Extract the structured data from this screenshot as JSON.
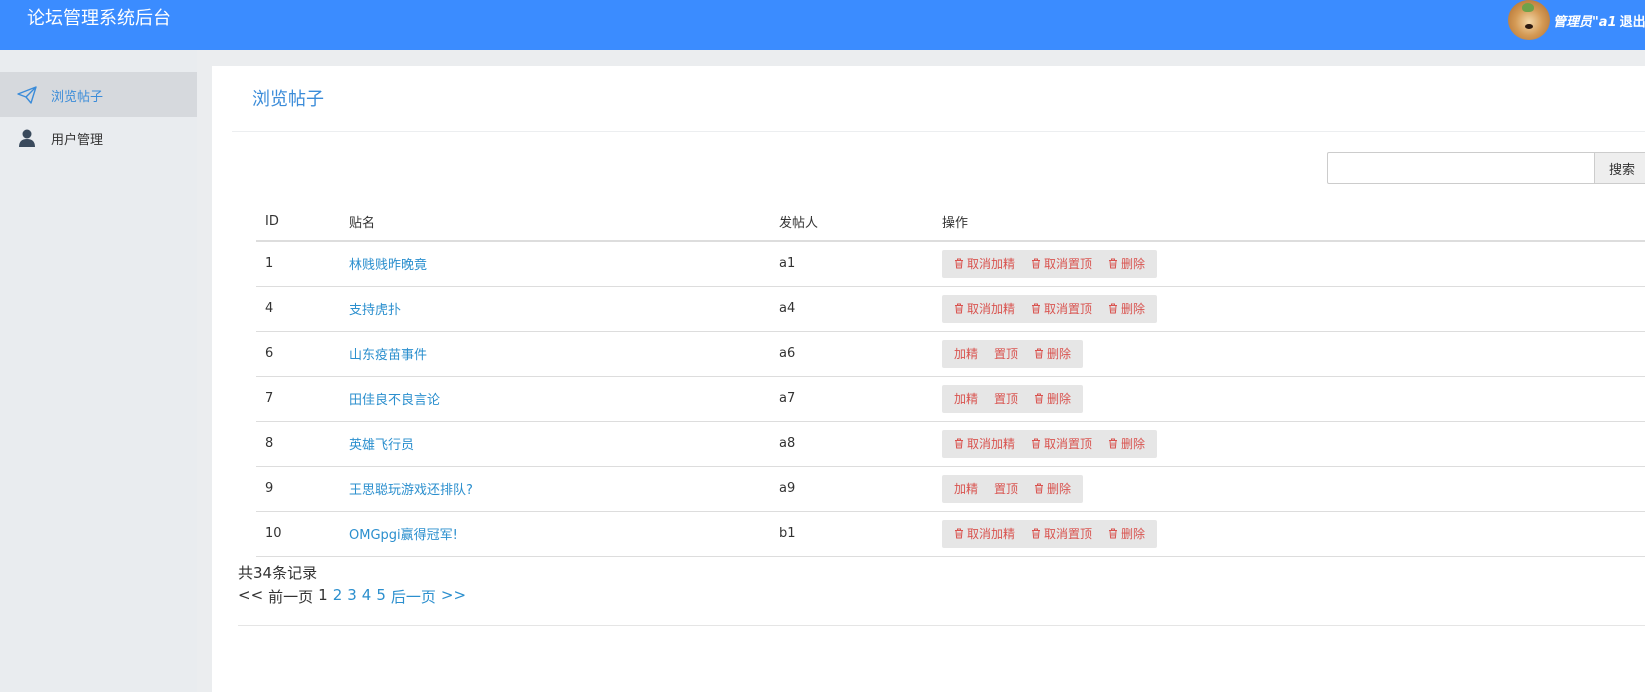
{
  "header": {
    "app_title": "论坛管理系统后台",
    "user_label": "管理员\"a1",
    "logout_label": "退出",
    "brand_color": "#3b8cff"
  },
  "sidebar": {
    "items": [
      {
        "label": "浏览帖子",
        "icon": "paper-plane-icon",
        "active": true
      },
      {
        "label": "用户管理",
        "icon": "user-icon",
        "active": false
      }
    ]
  },
  "main": {
    "page_title": "浏览帖子",
    "search": {
      "value": "",
      "button_label": "搜索"
    },
    "table": {
      "headers": {
        "id": "ID",
        "name": "贴名",
        "author": "发帖人",
        "ops": "操作"
      },
      "rows": [
        {
          "id": "1",
          "name": "林贱贱昨晚竟",
          "author": "a1",
          "ops": [
            "取消加精",
            "取消置顶",
            "删除"
          ]
        },
        {
          "id": "4",
          "name": "支持虎扑",
          "author": "a4",
          "ops": [
            "取消加精",
            "取消置顶",
            "删除"
          ]
        },
        {
          "id": "6",
          "name": "山东疫苗事件",
          "author": "a6",
          "ops": [
            "加精",
            "置顶",
            "删除"
          ]
        },
        {
          "id": "7",
          "name": "田佳良不良言论",
          "author": "a7",
          "ops": [
            "加精",
            "置顶",
            "删除"
          ]
        },
        {
          "id": "8",
          "name": "英雄飞行员",
          "author": "a8",
          "ops": [
            "取消加精",
            "取消置顶",
            "删除"
          ]
        },
        {
          "id": "9",
          "name": "王思聪玩游戏还排队?",
          "author": "a9",
          "ops": [
            "加精",
            "置顶",
            "删除"
          ]
        },
        {
          "id": "10",
          "name": "OMGpgi赢得冠军!",
          "author": "b1",
          "ops": [
            "取消加精",
            "取消置顶",
            "删除"
          ]
        }
      ]
    },
    "total_text": "共34条记录",
    "pager": {
      "first": "<<",
      "prev": "前一页",
      "current": "1",
      "pages": [
        "2",
        "3",
        "4",
        "5"
      ],
      "next": "后一页",
      "last": ">>"
    }
  }
}
